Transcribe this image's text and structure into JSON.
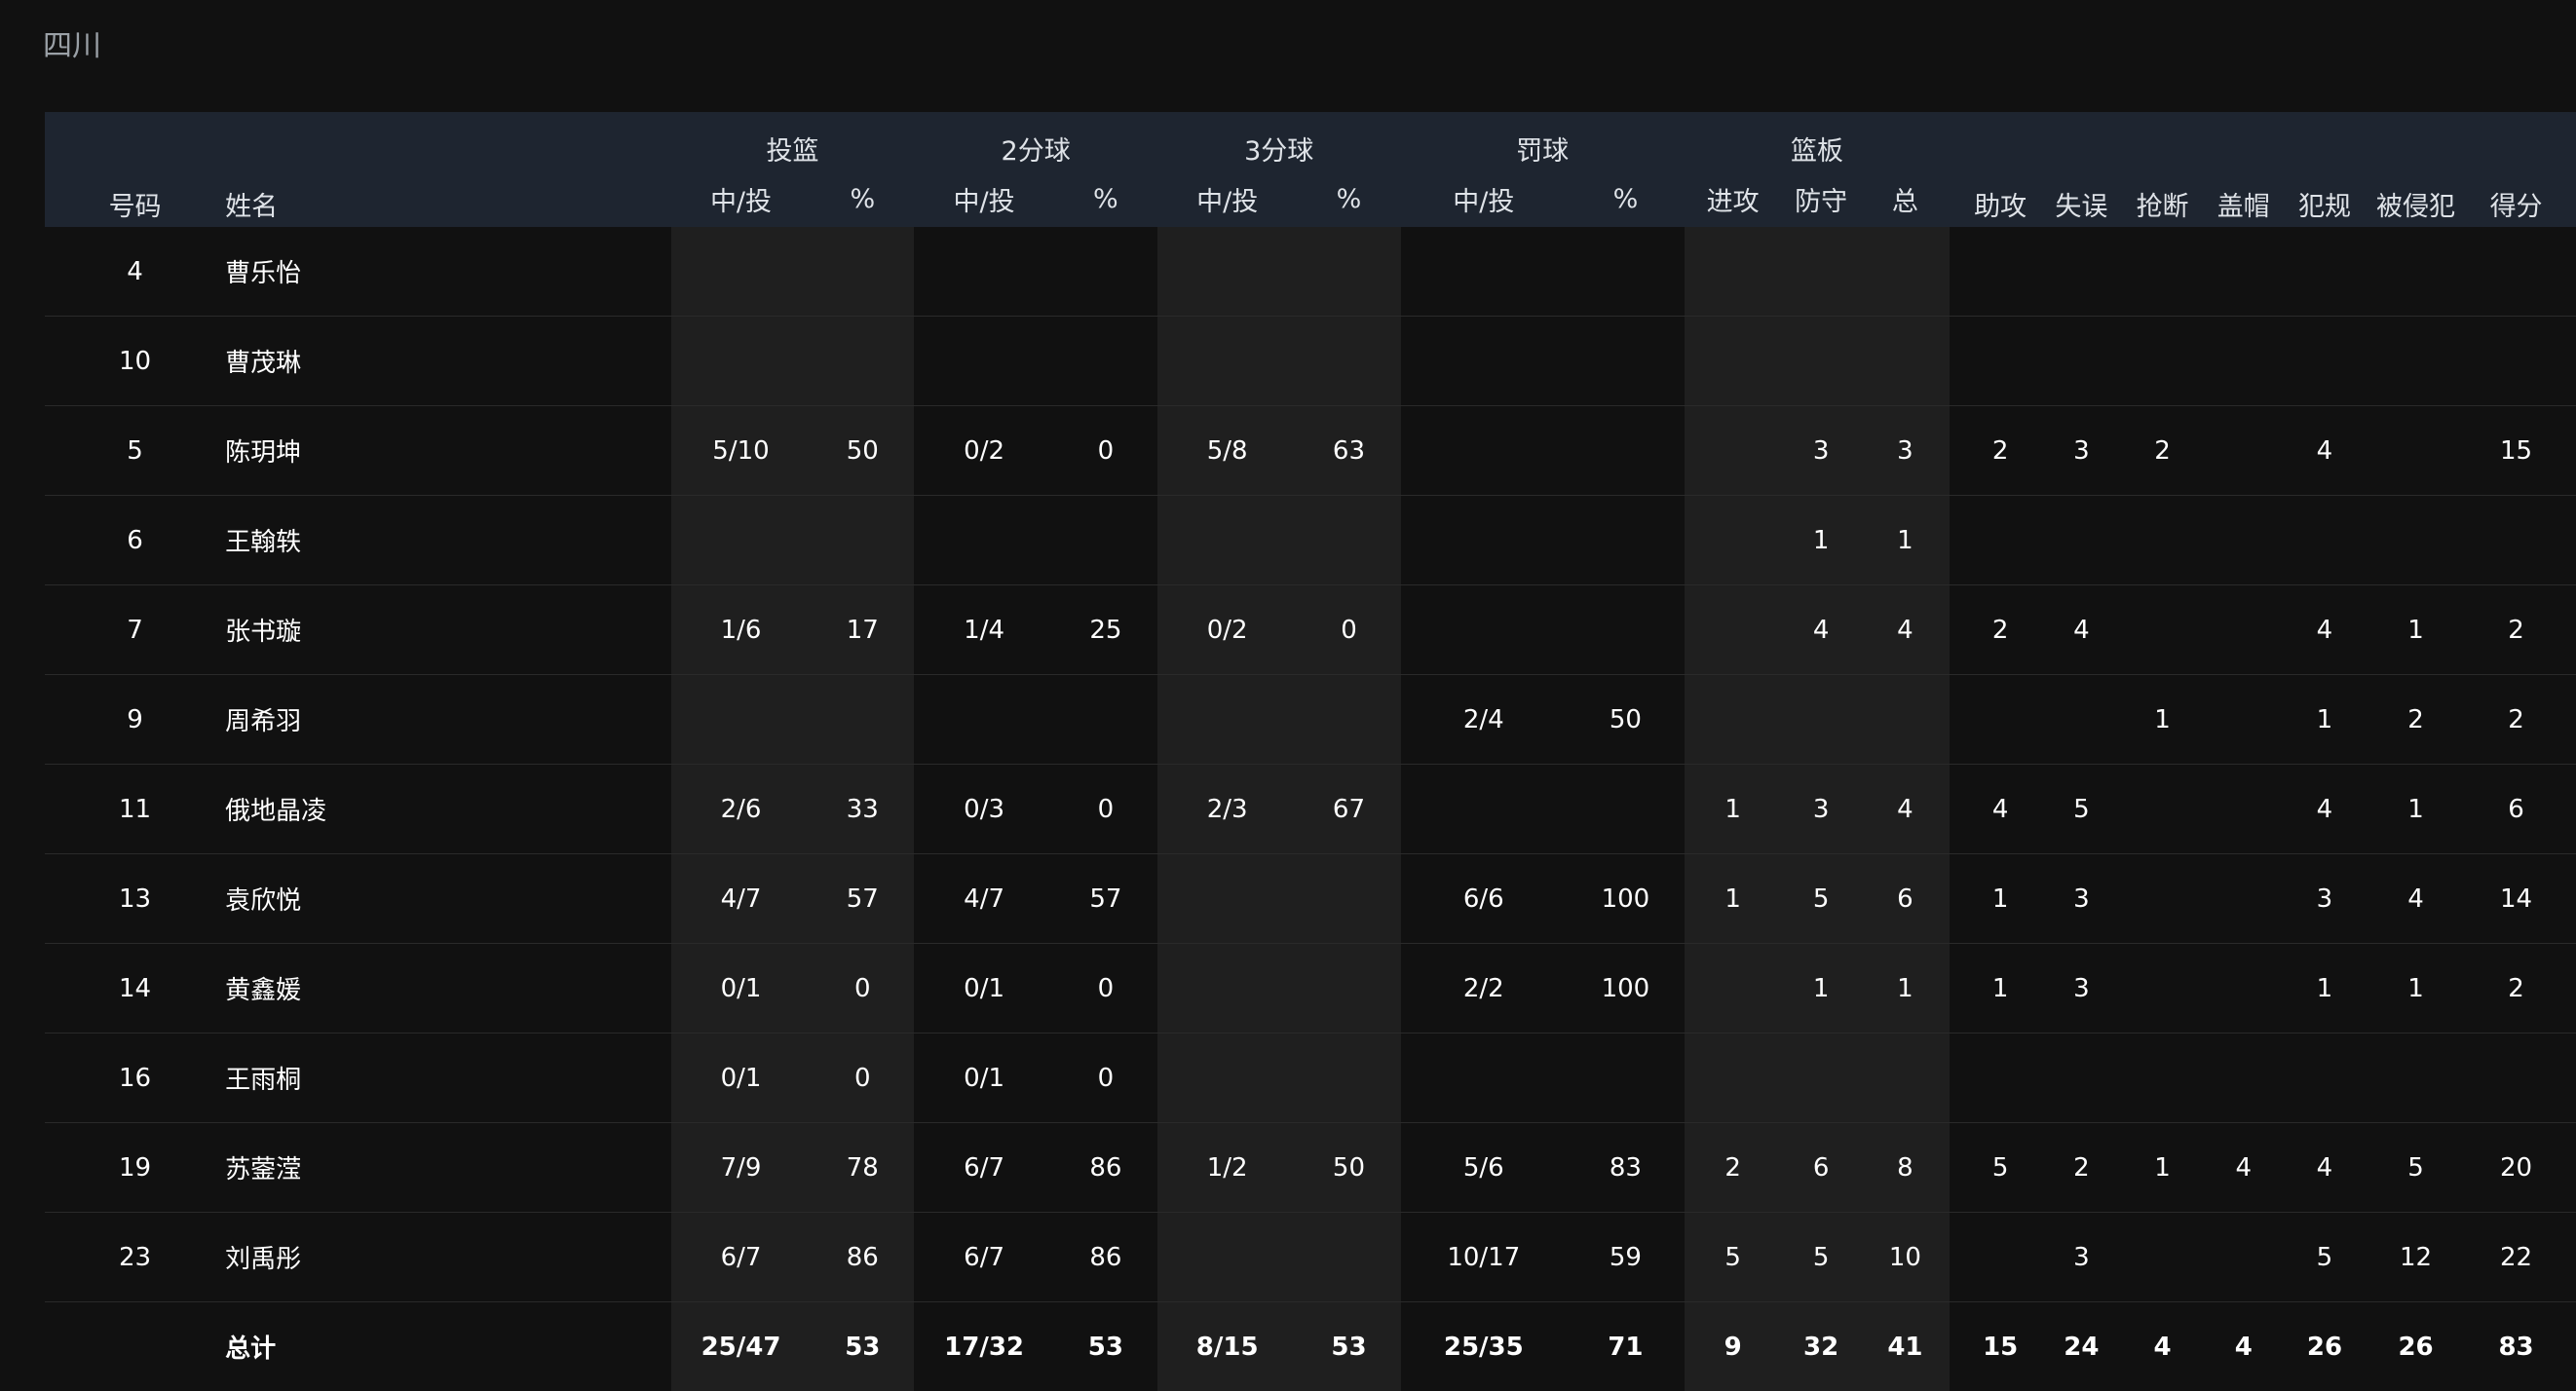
{
  "team": "四川",
  "headers": {
    "number": "号码",
    "name": "姓名",
    "fg": "投篮",
    "two": "2分球",
    "three": "3分球",
    "ft": "罚球",
    "reb": "篮板",
    "made_att": "中/投",
    "pct": "%",
    "oreb": "进攻",
    "dreb": "防守",
    "treb": "总",
    "ast": "助攻",
    "tov": "失误",
    "stl": "抢断",
    "blk": "盖帽",
    "pf": "犯规",
    "fd": "被侵犯",
    "pts": "得分"
  },
  "rows": [
    [
      "4",
      "曹乐怡",
      "",
      "",
      "",
      "",
      "",
      "",
      "",
      "",
      "",
      "",
      "",
      "",
      "",
      "",
      "",
      "",
      "",
      ""
    ],
    [
      "10",
      "曹茂琳",
      "",
      "",
      "",
      "",
      "",
      "",
      "",
      "",
      "",
      "",
      "",
      "",
      "",
      "",
      "",
      "",
      "",
      ""
    ],
    [
      "5",
      "陈玥坤",
      "5/10",
      "50",
      "0/2",
      "0",
      "5/8",
      "63",
      "",
      "",
      "",
      "3",
      "3",
      "2",
      "3",
      "2",
      "",
      "4",
      "",
      "15"
    ],
    [
      "6",
      "王翰轶",
      "",
      "",
      "",
      "",
      "",
      "",
      "",
      "",
      "",
      "1",
      "1",
      "",
      "",
      "",
      "",
      "",
      "",
      ""
    ],
    [
      "7",
      "张书璇",
      "1/6",
      "17",
      "1/4",
      "25",
      "0/2",
      "0",
      "",
      "",
      "",
      "4",
      "4",
      "2",
      "4",
      "",
      "",
      "4",
      "1",
      "2"
    ],
    [
      "9",
      "周希羽",
      "",
      "",
      "",
      "",
      "",
      "",
      "2/4",
      "50",
      "",
      "",
      "",
      "",
      "",
      "1",
      "",
      "1",
      "2",
      "2"
    ],
    [
      "11",
      "俄地晶凌",
      "2/6",
      "33",
      "0/3",
      "0",
      "2/3",
      "67",
      "",
      "",
      "1",
      "3",
      "4",
      "4",
      "5",
      "",
      "",
      "4",
      "1",
      "6"
    ],
    [
      "13",
      "袁欣悦",
      "4/7",
      "57",
      "4/7",
      "57",
      "",
      "",
      "6/6",
      "100",
      "1",
      "5",
      "6",
      "1",
      "3",
      "",
      "",
      "3",
      "4",
      "14"
    ],
    [
      "14",
      "黄鑫媛",
      "0/1",
      "0",
      "0/1",
      "0",
      "",
      "",
      "2/2",
      "100",
      "",
      "1",
      "1",
      "1",
      "3",
      "",
      "",
      "1",
      "1",
      "2"
    ],
    [
      "16",
      "王雨桐",
      "0/1",
      "0",
      "0/1",
      "0",
      "",
      "",
      "",
      "",
      "",
      "",
      "",
      "",
      "",
      "",
      "",
      "",
      "",
      ""
    ],
    [
      "19",
      "苏蓥滢",
      "7/9",
      "78",
      "6/7",
      "86",
      "1/2",
      "50",
      "5/6",
      "83",
      "2",
      "6",
      "8",
      "5",
      "2",
      "1",
      "4",
      "4",
      "5",
      "20"
    ],
    [
      "23",
      "刘禹彤",
      "6/7",
      "86",
      "6/7",
      "86",
      "",
      "",
      "10/17",
      "59",
      "5",
      "5",
      "10",
      "",
      "3",
      "",
      "",
      "5",
      "12",
      "22"
    ],
    [
      "",
      "总计",
      "25/47",
      "53",
      "17/32",
      "53",
      "8/15",
      "53",
      "25/35",
      "71",
      "9",
      "32",
      "41",
      "15",
      "24",
      "4",
      "4",
      "26",
      "26",
      "83"
    ]
  ]
}
